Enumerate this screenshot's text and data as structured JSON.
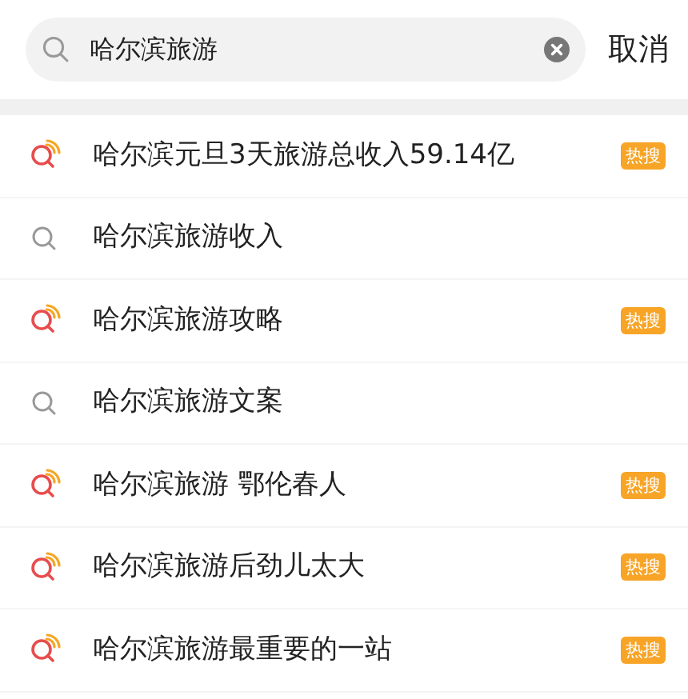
{
  "search": {
    "value": "哈尔滨旅游",
    "cancel": "取消"
  },
  "suggestions": [
    {
      "kind": "hot",
      "text": "哈尔滨元旦3天旅游总收入59.14亿",
      "badge": "热搜"
    },
    {
      "kind": "normal",
      "text": "哈尔滨旅游收入"
    },
    {
      "kind": "hot",
      "text": "哈尔滨旅游攻略",
      "badge": "热搜"
    },
    {
      "kind": "normal",
      "text": "哈尔滨旅游文案"
    },
    {
      "kind": "hot",
      "text": "哈尔滨旅游 鄂伦春人",
      "badge": "热搜"
    },
    {
      "kind": "hot",
      "text": "哈尔滨旅游后劲儿太大",
      "badge": "热搜"
    },
    {
      "kind": "hot",
      "text": "哈尔滨旅游最重要的一站",
      "badge": "热搜"
    }
  ]
}
